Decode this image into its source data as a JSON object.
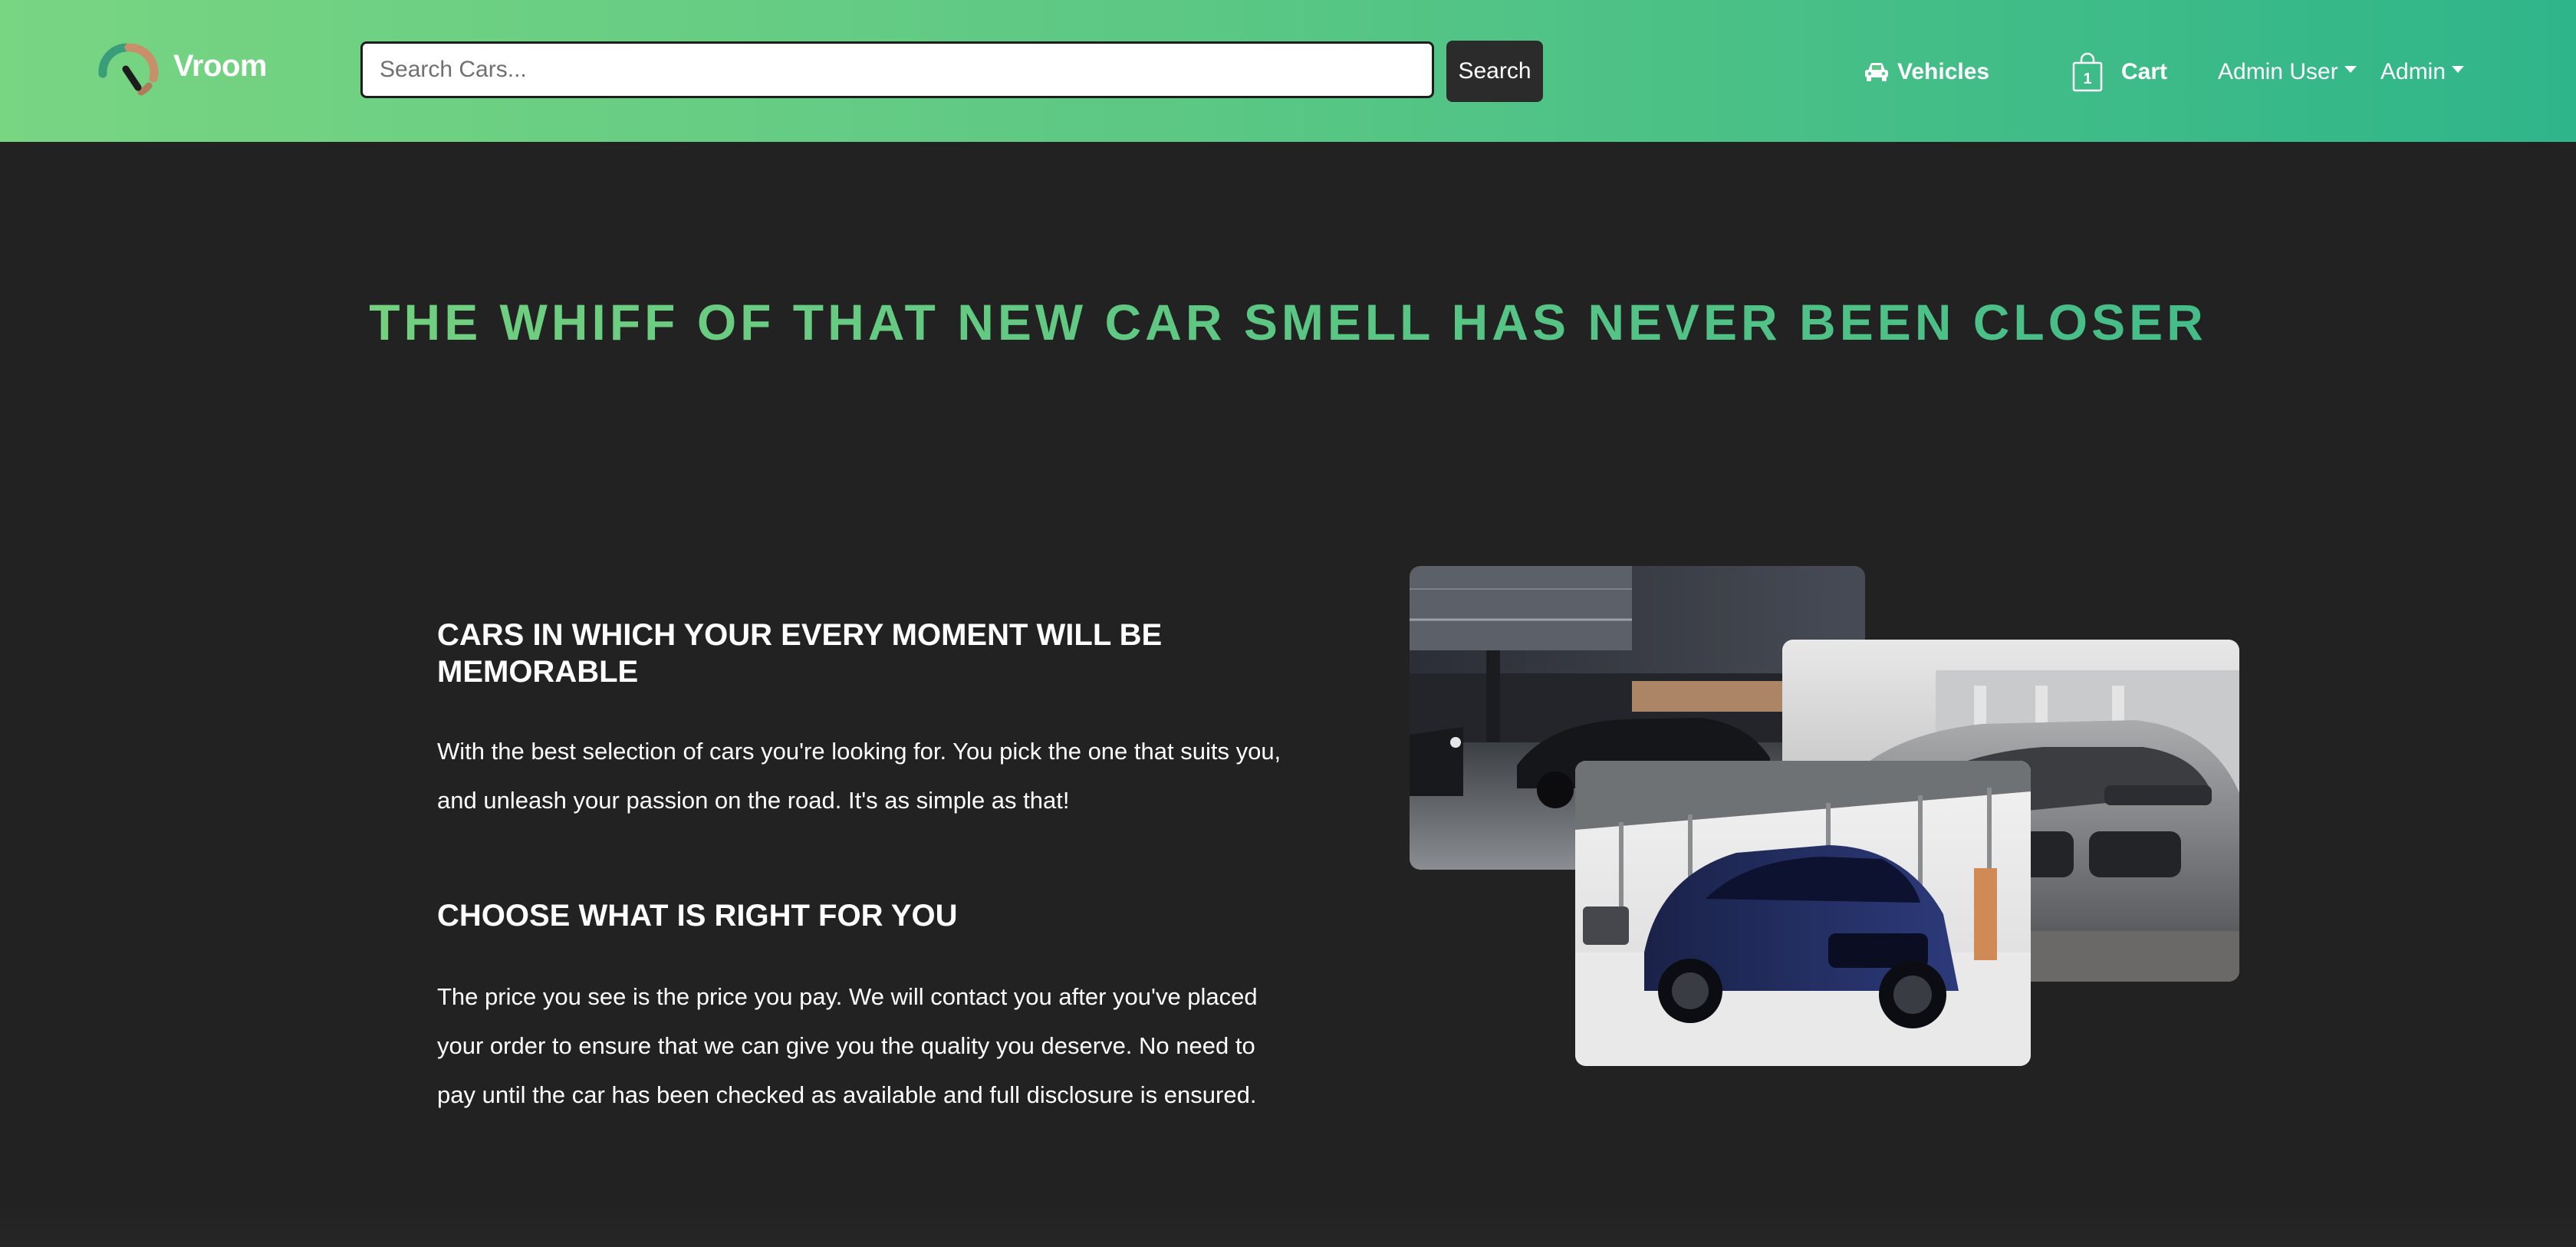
{
  "navbar": {
    "brand": "Vroom",
    "search_placeholder": "Search Cars...",
    "search_button": "Search",
    "links": {
      "vehicles": "Vehicles",
      "cart": "Cart",
      "cart_count": "1",
      "admin_user": "Admin User",
      "admin": "Admin"
    }
  },
  "hero": {
    "title": "THE WHIFF OF THAT NEW CAR SMELL HAS NEVER BEEN CLOSER"
  },
  "sections": {
    "memorable": {
      "heading": "CARS IN WHICH YOUR EVERY MOMENT WILL BE MEMORABLE",
      "text": "With the best selection of cars you're looking for. You pick the one that suits you, and unleash your passion on the road. It's as simple as that!"
    },
    "choose": {
      "heading": "CHOOSE WHAT IS RIGHT FOR YOU",
      "text": "The price you see is the price you pay. We will contact you after you've placed your order to ensure that we can give you the quality you deserve. No need to pay until the car has been checked as available and full disclosure is ensured."
    }
  },
  "colors": {
    "navbar_gradient_start": "#78d582",
    "navbar_gradient_end": "#2fb58a",
    "page_background": "#222222",
    "hero_title": "#5ec786",
    "search_button": "#2b2b2b"
  },
  "icons": {
    "brand": "speedometer-logo-icon",
    "vehicles": "car-icon",
    "cart": "shopping-bag-icon",
    "dropdown": "caret-down-icon"
  }
}
